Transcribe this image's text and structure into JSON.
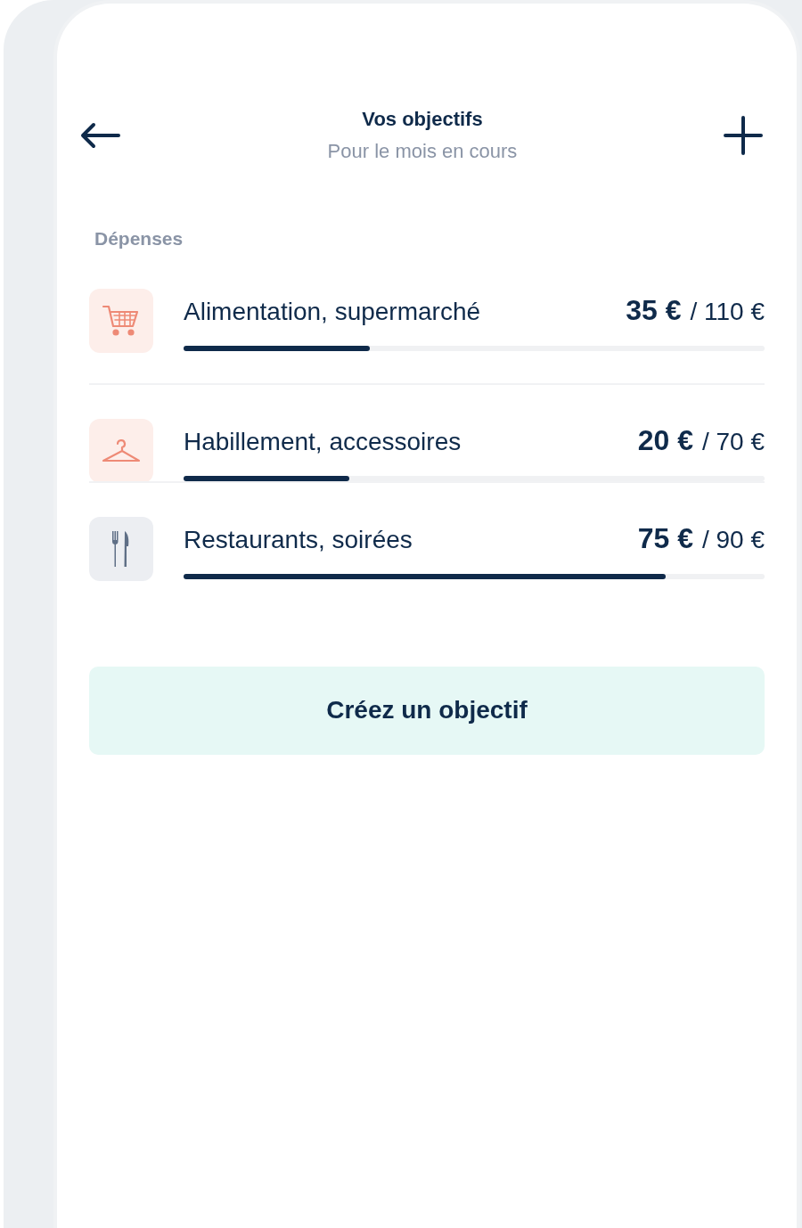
{
  "header": {
    "title": "Vos objectifs",
    "subtitle": "Pour le mois en cours"
  },
  "section_label": "Dépenses",
  "goals": [
    {
      "kind": "cart",
      "name": "Alimentation, supermarché",
      "spent": "35 €",
      "budget": "/ 110 €",
      "level": 0.32
    },
    {
      "kind": "hanger",
      "name": "Habillement, accessoires",
      "spent": "20 €",
      "budget": "/ 70 €",
      "level": 0.285
    },
    {
      "kind": "cutlery",
      "name": "Restaurants, soirées",
      "spent": "75 €",
      "budget": "/ 90 €",
      "level": 0.83
    }
  ],
  "button": "Créez un objectif"
}
